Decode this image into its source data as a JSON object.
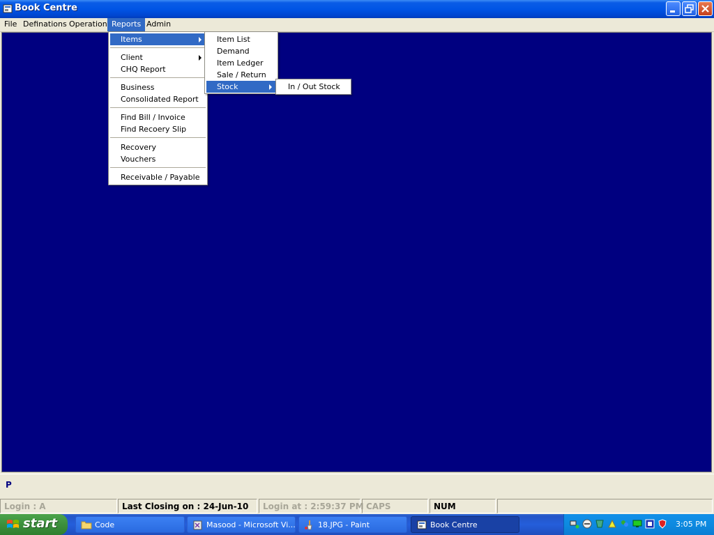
{
  "window": {
    "title": "Book Centre"
  },
  "menubar": {
    "items": [
      {
        "label": "File"
      },
      {
        "label": "Definations"
      },
      {
        "label": "Operation"
      },
      {
        "label": "Reports"
      },
      {
        "label": "Admin"
      }
    ]
  },
  "reports_menu": {
    "items": [
      {
        "label": "Items",
        "submenu": true,
        "highlighted": true
      },
      {
        "label": "Client",
        "submenu": true
      },
      {
        "label": "CHQ Report"
      },
      {
        "label": "Business"
      },
      {
        "label": "Consolidated Report"
      },
      {
        "label": "Find Bill / Invoice"
      },
      {
        "label": "Find Recoery Slip"
      },
      {
        "label": "Recovery"
      },
      {
        "label": "Vouchers"
      },
      {
        "label": "Receivable / Payable"
      }
    ]
  },
  "items_submenu": {
    "items": [
      {
        "label": "Item List"
      },
      {
        "label": "Demand"
      },
      {
        "label": "Item Ledger"
      },
      {
        "label": "Sale / Return"
      },
      {
        "label": "Stock",
        "submenu": true,
        "highlighted": true
      }
    ]
  },
  "stock_submenu": {
    "items": [
      {
        "label": "In / Out Stock"
      }
    ]
  },
  "command_line": {
    "prompt": "P"
  },
  "statusbar": {
    "login": "Login :  A",
    "last_closing": "Last Closing on : 24-Jun-10",
    "login_at": "Login at : 2:59:37 PM",
    "caps": "CAPS",
    "num": "NUM"
  },
  "taskbar": {
    "start_label": "start",
    "tasks": [
      {
        "label": "Code"
      },
      {
        "label": "Masood - Microsoft Vi..."
      },
      {
        "label": "18.JPG - Paint"
      },
      {
        "label": "Book Centre"
      }
    ],
    "clock": "3:05 PM"
  },
  "colors": {
    "workspace": "#000080",
    "highlight": "#316ac5",
    "titlebar": "#0055e5"
  }
}
